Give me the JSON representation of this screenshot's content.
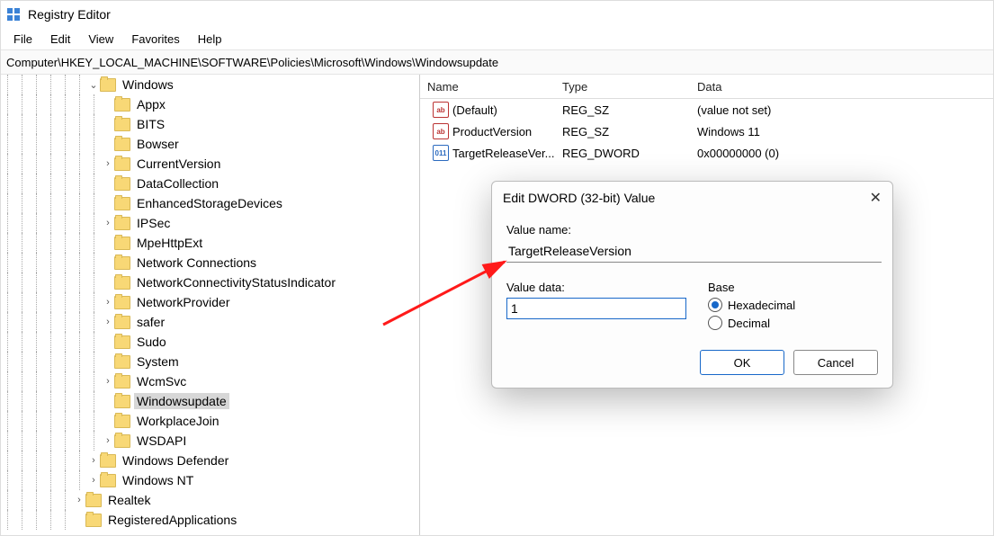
{
  "title": "Registry Editor",
  "menu": {
    "file": "File",
    "edit": "Edit",
    "view": "View",
    "favorites": "Favorites",
    "help": "Help"
  },
  "address": "Computer\\HKEY_LOCAL_MACHINE\\SOFTWARE\\Policies\\Microsoft\\Windows\\Windowsupdate",
  "tree": [
    {
      "depth": 7,
      "chev": "down",
      "label": "Windows",
      "sel": false
    },
    {
      "depth": 8,
      "chev": "none",
      "label": "Appx"
    },
    {
      "depth": 8,
      "chev": "none",
      "label": "BITS"
    },
    {
      "depth": 8,
      "chev": "none",
      "label": "Bowser"
    },
    {
      "depth": 8,
      "chev": "right",
      "label": "CurrentVersion"
    },
    {
      "depth": 8,
      "chev": "none",
      "label": "DataCollection"
    },
    {
      "depth": 8,
      "chev": "none",
      "label": "EnhancedStorageDevices"
    },
    {
      "depth": 8,
      "chev": "right",
      "label": "IPSec"
    },
    {
      "depth": 8,
      "chev": "none",
      "label": "MpeHttpExt"
    },
    {
      "depth": 8,
      "chev": "none",
      "label": "Network Connections"
    },
    {
      "depth": 8,
      "chev": "none",
      "label": "NetworkConnectivityStatusIndicator"
    },
    {
      "depth": 8,
      "chev": "right",
      "label": "NetworkProvider"
    },
    {
      "depth": 8,
      "chev": "right",
      "label": "safer"
    },
    {
      "depth": 8,
      "chev": "none",
      "label": "Sudo"
    },
    {
      "depth": 8,
      "chev": "none",
      "label": "System"
    },
    {
      "depth": 8,
      "chev": "right",
      "label": "WcmSvc"
    },
    {
      "depth": 8,
      "chev": "none",
      "label": "Windowsupdate",
      "sel": true
    },
    {
      "depth": 8,
      "chev": "none",
      "label": "WorkplaceJoin"
    },
    {
      "depth": 8,
      "chev": "right",
      "label": "WSDAPI"
    },
    {
      "depth": 7,
      "chev": "right",
      "label": "Windows Defender"
    },
    {
      "depth": 7,
      "chev": "right",
      "label": "Windows NT"
    },
    {
      "depth": 6,
      "chev": "right",
      "label": "Realtek"
    },
    {
      "depth": 6,
      "chev": "none",
      "label": "RegisteredApplications"
    }
  ],
  "list": {
    "headers": {
      "name": "Name",
      "type": "Type",
      "data": "Data"
    },
    "rows": [
      {
        "icon": "sz",
        "name": "(Default)",
        "type": "REG_SZ",
        "data": "(value not set)"
      },
      {
        "icon": "sz",
        "name": "ProductVersion",
        "type": "REG_SZ",
        "data": "Windows 11"
      },
      {
        "icon": "dw",
        "name": "TargetReleaseVer...",
        "type": "REG_DWORD",
        "data": "0x00000000 (0)"
      }
    ]
  },
  "dialog": {
    "title": "Edit DWORD (32-bit) Value",
    "valueNameLabel": "Value name:",
    "valueName": "TargetReleaseVersion",
    "valueDataLabel": "Value data:",
    "valueData": "1",
    "baseLabel": "Base",
    "hex": "Hexadecimal",
    "dec": "Decimal",
    "ok": "OK",
    "cancel": "Cancel"
  }
}
